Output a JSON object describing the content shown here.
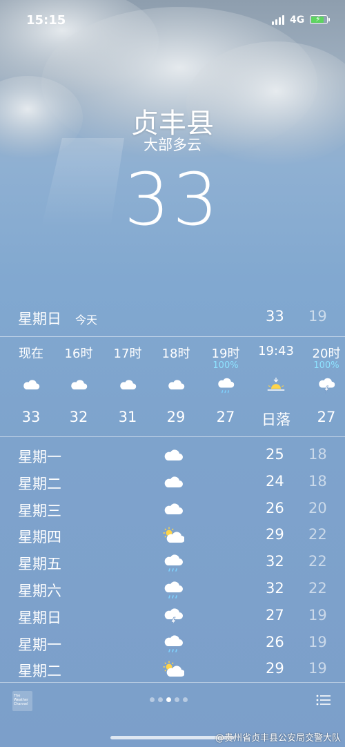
{
  "status_bar": {
    "time": "15:15",
    "network": "4G"
  },
  "location": {
    "city": "贞丰县",
    "condition": "大部多云",
    "temperature": "33"
  },
  "today": {
    "day": "星期日",
    "tag": "今天",
    "high": "33",
    "low": "19"
  },
  "hourly": [
    {
      "time": "现在",
      "precip": "",
      "icon": "cloud-icon",
      "temp": "33"
    },
    {
      "time": "16时",
      "precip": "",
      "icon": "cloud-icon",
      "temp": "32"
    },
    {
      "time": "17时",
      "precip": "",
      "icon": "cloud-icon",
      "temp": "31"
    },
    {
      "time": "18时",
      "precip": "",
      "icon": "cloud-icon",
      "temp": "29"
    },
    {
      "time": "19时",
      "precip": "100%",
      "icon": "rain-icon",
      "temp": "27"
    },
    {
      "time": "19:43",
      "precip": "",
      "icon": "sunset-icon",
      "temp": "日落"
    },
    {
      "time": "20时",
      "precip": "100%",
      "icon": "thunderstorm-icon",
      "temp": "27"
    }
  ],
  "daily": [
    {
      "day": "星期一",
      "icon": "cloud-icon",
      "high": "25",
      "low": "18"
    },
    {
      "day": "星期二",
      "icon": "cloud-icon",
      "high": "24",
      "low": "18"
    },
    {
      "day": "星期三",
      "icon": "cloud-icon",
      "high": "26",
      "low": "20"
    },
    {
      "day": "星期四",
      "icon": "partly-sunny-icon",
      "high": "29",
      "low": "22"
    },
    {
      "day": "星期五",
      "icon": "rain-icon",
      "high": "32",
      "low": "22"
    },
    {
      "day": "星期六",
      "icon": "rain-icon",
      "high": "32",
      "low": "22"
    },
    {
      "day": "星期日",
      "icon": "thunderstorm-icon",
      "high": "27",
      "low": "19"
    },
    {
      "day": "星期一",
      "icon": "rain-icon",
      "high": "26",
      "low": "19"
    },
    {
      "day": "星期二",
      "icon": "partly-sunny-icon",
      "high": "29",
      "low": "19"
    }
  ],
  "footer": {
    "logo_text": "The Weather Channel",
    "page_count": 5,
    "active_page": 3
  },
  "watermark": "@贵州省贞丰县公安局交警大队",
  "colors": {
    "precip_text": "#8ee2ff",
    "battery_fill": "#5ed560",
    "sun": "#ffd54a"
  }
}
